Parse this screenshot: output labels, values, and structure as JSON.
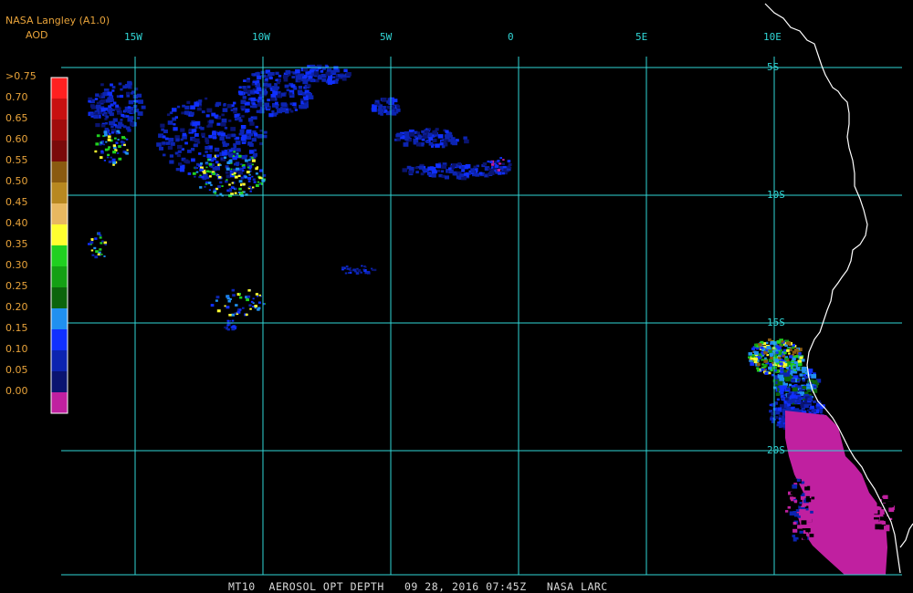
{
  "header": {
    "source": "NASA Langley (A1.0)",
    "product": "AOD"
  },
  "caption": "MT10  AEROSOL OPT DEPTH   09 28, 2016 07:45Z   NASA LARC",
  "grid": {
    "longitudes": [
      {
        "value": -15,
        "label": "15W"
      },
      {
        "value": -10,
        "label": "10W"
      },
      {
        "value": -5,
        "label": "5W"
      },
      {
        "value": 0,
        "label": "0"
      },
      {
        "value": 5,
        "label": "5E"
      },
      {
        "value": 10,
        "label": "10E"
      }
    ],
    "latitudes": [
      {
        "value": -5,
        "label": "5S"
      },
      {
        "value": -10,
        "label": "10S"
      },
      {
        "value": -15,
        "label": "15S"
      },
      {
        "value": -20,
        "label": "20S"
      }
    ],
    "color": "#31d6d6"
  },
  "legend": {
    "title": "AOD",
    "entries": [
      {
        "label": ">0.75",
        "color": "#ff2020"
      },
      {
        "label": "0.70",
        "color": "#c81010"
      },
      {
        "label": "0.65",
        "color": "#a00c0c"
      },
      {
        "label": "0.60",
        "color": "#7a0a0a"
      },
      {
        "label": "0.55",
        "color": "#8a5a10"
      },
      {
        "label": "0.50",
        "color": "#b88820"
      },
      {
        "label": "0.45",
        "color": "#e8b860"
      },
      {
        "label": "0.40",
        "color": "#ffff30"
      },
      {
        "label": "0.35",
        "color": "#20d020"
      },
      {
        "label": "0.30",
        "color": "#14a014"
      },
      {
        "label": "0.25",
        "color": "#0c640c"
      },
      {
        "label": "0.20",
        "color": "#2090f0"
      },
      {
        "label": "0.15",
        "color": "#1030ff"
      },
      {
        "label": "0.10",
        "color": "#0c24b0"
      },
      {
        "label": "0.05",
        "color": "#0a1470"
      },
      {
        "label": "0.00",
        "color": "#c020a0"
      }
    ]
  },
  "coastline_color": "#ffffff"
}
